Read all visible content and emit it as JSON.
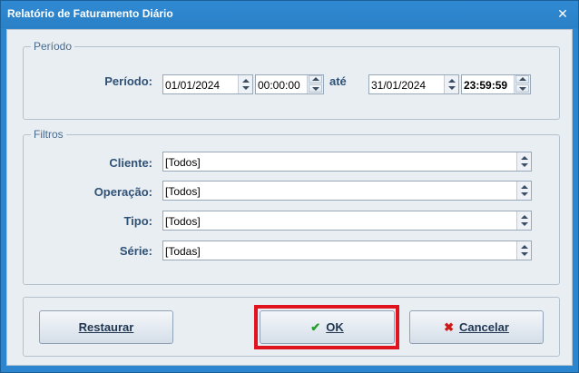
{
  "window": {
    "title": "Relatório de Faturamento Diário",
    "close_symbol": "✕"
  },
  "periodo_group": {
    "caption": "Período",
    "label": "Período:",
    "start_date": "01/01/2024",
    "start_time": "00:00:00",
    "separator": "até",
    "end_date": "31/01/2024",
    "end_time": "23:59:59"
  },
  "filtros_group": {
    "caption": "Filtros",
    "rows": [
      {
        "label": "Cliente:",
        "value": "[Todos]"
      },
      {
        "label": "Operação:",
        "value": "[Todos]"
      },
      {
        "label": "Tipo:",
        "value": "[Todos]"
      },
      {
        "label": "Série:",
        "value": "[Todas]"
      }
    ]
  },
  "buttons": {
    "restaurar": "Restaurar",
    "ok": "OK",
    "cancelar": "Cancelar"
  },
  "icons": {
    "ok": "check-icon",
    "cancelar": "x-icon"
  },
  "colors": {
    "title_bar": "#2c86cf",
    "highlight": "#e0141e",
    "ok_icon": "#22a02a",
    "cancel_icon": "#d01919"
  }
}
